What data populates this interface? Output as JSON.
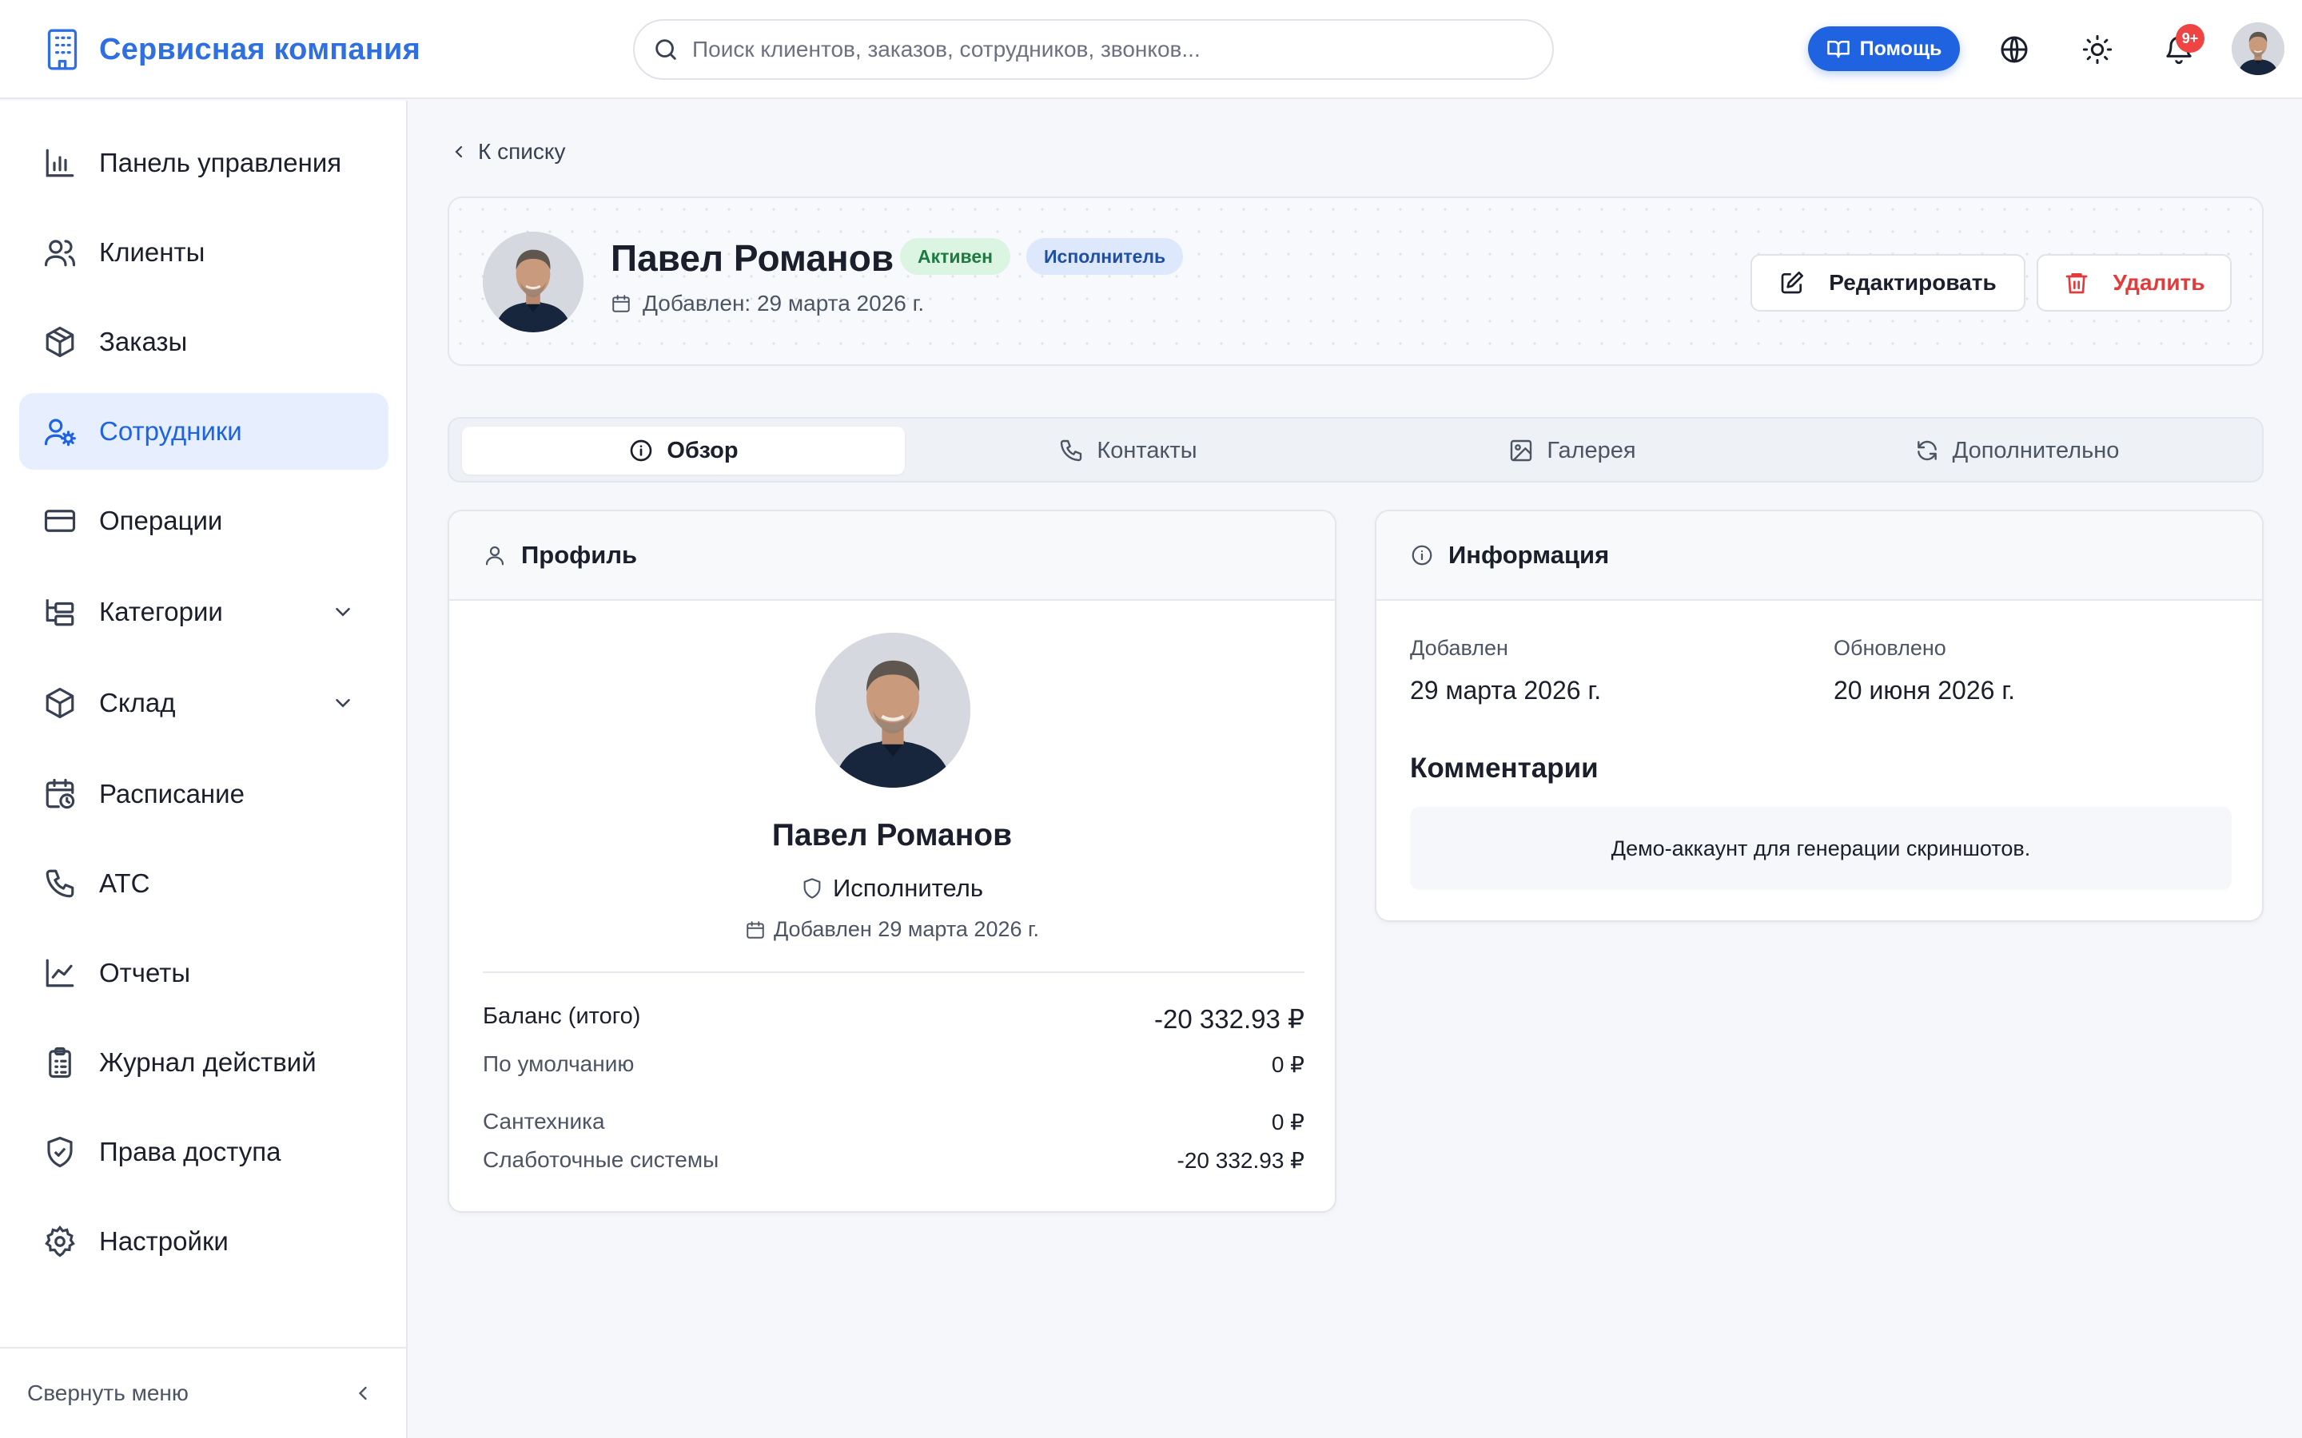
{
  "header": {
    "brand_title": "Сервисная компания",
    "search_placeholder": "Поиск клиентов, заказов, сотрудников, звонков...",
    "help_label": "Помощь",
    "notifications_badge": "9+"
  },
  "sidebar": {
    "items": [
      {
        "label": "Панель управления",
        "icon": "chart-icon"
      },
      {
        "label": "Клиенты",
        "icon": "users-icon"
      },
      {
        "label": "Заказы",
        "icon": "box-icon"
      },
      {
        "label": "Сотрудники",
        "icon": "user-cog-icon",
        "active": true
      },
      {
        "label": "Операции",
        "icon": "credit-card-icon"
      },
      {
        "label": "Категории",
        "icon": "folder-tree-icon",
        "expandable": true
      },
      {
        "label": "Склад",
        "icon": "package-icon",
        "expandable": true
      },
      {
        "label": "Расписание",
        "icon": "calendar-clock-icon"
      },
      {
        "label": "АТС",
        "icon": "phone-icon"
      },
      {
        "label": "Отчеты",
        "icon": "line-chart-icon"
      },
      {
        "label": "Журнал действий",
        "icon": "clipboard-icon"
      },
      {
        "label": "Права доступа",
        "icon": "shield-check-icon"
      },
      {
        "label": "Настройки",
        "icon": "gear-icon"
      }
    ],
    "collapse_label": "Свернуть меню"
  },
  "main": {
    "back_label": "К списку",
    "employee": {
      "name": "Павел Романов",
      "status_badge": "Активен",
      "role_badge": "Исполнитель",
      "added_text": "Добавлен: 29 марта 2026 г."
    },
    "actions": {
      "edit_label": "Редактировать",
      "delete_label": "Удалить"
    },
    "tabs": [
      {
        "label": "Обзор",
        "active": true
      },
      {
        "label": "Контакты"
      },
      {
        "label": "Галерея"
      },
      {
        "label": "Дополнительно"
      }
    ],
    "profile_card": {
      "title": "Профиль",
      "name": "Павел Романов",
      "role": "Исполнитель",
      "added_text": "Добавлен 29 марта 2026 г.",
      "balance_total_label": "Баланс (итого)",
      "balance_total_value": "-20 332.93 ₽",
      "balances": [
        {
          "label": "По умолчанию",
          "value": "0 ₽"
        },
        {
          "label": "Сантехника",
          "value": "0 ₽"
        },
        {
          "label": "Слаботочные системы",
          "value": "-20 332.93 ₽"
        }
      ]
    },
    "info_card": {
      "title": "Информация",
      "added_label": "Добавлен",
      "added_value": "29 марта 2026 г.",
      "updated_label": "Обновлено",
      "updated_value": "20 июня 2026 г.",
      "comments_title": "Комментарии",
      "comment_text": "Демо-аккаунт для генерации скриншотов."
    }
  },
  "colors": {
    "accent": "#1f63e0",
    "brand": "#2f6fe0",
    "active_badge_bg": "#dcf5e3",
    "role_badge_bg": "#dde8fc",
    "danger": "#e23b3b",
    "notification": "#ef4444"
  }
}
